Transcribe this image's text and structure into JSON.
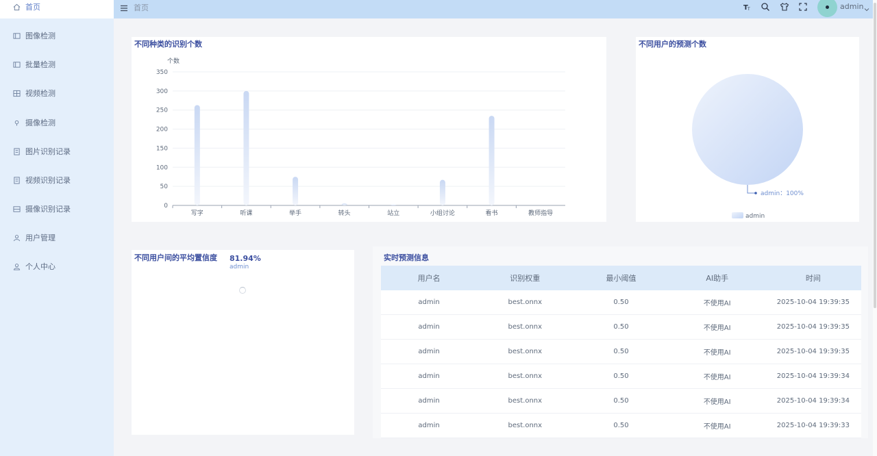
{
  "sidebar": {
    "items": [
      {
        "label": "首页",
        "icon": "home-icon"
      },
      {
        "label": "图像检测",
        "icon": "image-icon"
      },
      {
        "label": "批量检测",
        "icon": "batch-icon"
      },
      {
        "label": "视频检测",
        "icon": "video-icon"
      },
      {
        "label": "摄像检测",
        "icon": "camera-icon"
      },
      {
        "label": "图片识别记录",
        "icon": "record-icon"
      },
      {
        "label": "视频识别记录",
        "icon": "record-icon"
      },
      {
        "label": "摄像识别记录",
        "icon": "record-icon"
      },
      {
        "label": "用户管理",
        "icon": "user-icon"
      },
      {
        "label": "个人中心",
        "icon": "user-icon"
      }
    ]
  },
  "header": {
    "breadcrumb": "首页",
    "user_name": "admin"
  },
  "bar_card": {
    "title": "不同种类的识别个数"
  },
  "pie_card": {
    "title": "不同用户的预测个数",
    "slice_label": "admin：100%",
    "legend_label": "admin"
  },
  "conf_card": {
    "title": "不同用户间的平均置信度",
    "value": "81.94%",
    "user": "admin"
  },
  "table_card": {
    "title": "实时预测信息",
    "columns": [
      "用户名",
      "识别权重",
      "最小阈值",
      "AI助手",
      "时间"
    ],
    "rows": [
      [
        "admin",
        "best.onnx",
        "0.50",
        "不使用AI",
        "2025-10-04 19:39:35"
      ],
      [
        "admin",
        "best.onnx",
        "0.50",
        "不使用AI",
        "2025-10-04 19:39:35"
      ],
      [
        "admin",
        "best.onnx",
        "0.50",
        "不使用AI",
        "2025-10-04 19:39:35"
      ],
      [
        "admin",
        "best.onnx",
        "0.50",
        "不使用AI",
        "2025-10-04 19:39:34"
      ],
      [
        "admin",
        "best.onnx",
        "0.50",
        "不使用AI",
        "2025-10-04 19:39:34"
      ],
      [
        "admin",
        "best.onnx",
        "0.50",
        "不使用AI",
        "2025-10-04 19:39:33"
      ]
    ]
  },
  "chart_data": [
    {
      "type": "bar",
      "title": "不同种类的识别个数",
      "ylabel": "个数",
      "categories": [
        "写字",
        "听课",
        "举手",
        "转头",
        "站立",
        "小组讨论",
        "看书",
        "教师指导"
      ],
      "values": [
        263,
        300,
        75,
        5,
        2,
        67,
        235,
        0
      ],
      "ylim": [
        0,
        350
      ],
      "yticks": [
        "0",
        "50",
        "100",
        "150",
        "200",
        "250",
        "300",
        "350"
      ],
      "grid": true,
      "bar_color": "#c9d8f3"
    },
    {
      "type": "pie",
      "title": "不同用户的预测个数",
      "labels": [
        "admin"
      ],
      "values": [
        100
      ],
      "legend": "bottom",
      "slice_color": "#c3d5f5"
    }
  ],
  "colors": {
    "accent": "#3c4fa0",
    "sidebar_bg": "#e4effb",
    "header_bg": "#c3dcf6"
  }
}
